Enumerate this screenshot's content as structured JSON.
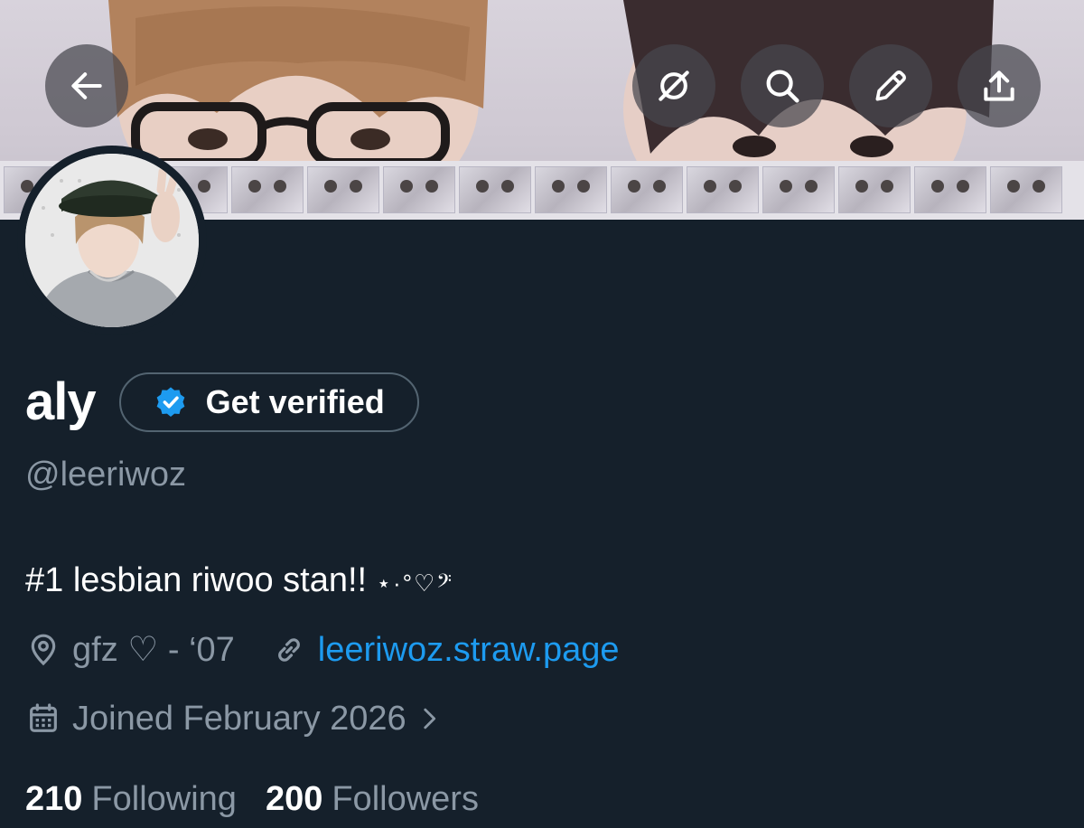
{
  "header": {
    "back_icon": "arrow-left-icon",
    "actions": [
      {
        "name": "grok-icon"
      },
      {
        "name": "search-icon"
      },
      {
        "name": "pencil-icon"
      },
      {
        "name": "share-icon"
      }
    ]
  },
  "profile": {
    "display_name": "aly",
    "get_verified_label": "Get verified",
    "handle": "@leeriwoz",
    "bio_text": "#1 lesbian riwoo stan!! ",
    "bio_deco": "⋆·°♡𝄢",
    "location": "gfz ♡ - ‘07",
    "website": "leeriwoz.straw.page",
    "joined": "Joined February 2026",
    "following_count": "210",
    "following_label": "Following",
    "followers_count": "200",
    "followers_label": "Followers"
  },
  "colors": {
    "background": "#15202b",
    "secondary_text": "#8b98a5",
    "link": "#1d9bf0",
    "verified_badge": "#1d9bf0"
  }
}
